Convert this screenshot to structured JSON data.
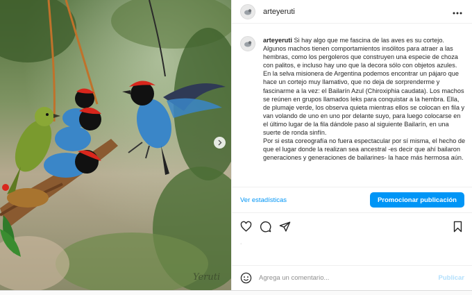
{
  "post": {
    "username": "arteyeruti",
    "caption_text": "Si hay algo que me fascina de las aves es su cortejo. Algunos machos tienen comportamientos insólitos para atraer a las hembras, como los pergoleros que construyen una especie de choza con palitos, e incluso hay uno que la decora sólo con objetos azules.",
    "caption_paragraphs": [
      "En la selva misionera de Argentina podemos encontrar un pájaro que hace un cortejo muy llamativo, que no deja de sorprenderme y fascinarme a la vez: el Bailarín Azul (Chiroxiphia caudata). Los machos se reúnen en grupos llamados leks para conquistar a la hembra. Ella, de plumaje verde, los observa quieta mientras ellos se colocan en fila y van volando de uno en uno por delante suyo, para luego colocarse en el último lugar de la fila dándole paso al siguiente Bailarín, en una suerte de ronda sinfín.",
      "Por si esta coreografía no fuera espectacular por sí misma, el hecho de que el lugar donde la realizan sea ancestral -es decir que ahí bailaron generaciones y generaciones de bailarines- la hace más hermosa aún."
    ],
    "more_icon": "ellipsis-icon",
    "watermark": "Yeruti"
  },
  "actions": {
    "stats_label": "Ver estadísticas",
    "promote_label": "Promocionar publicación",
    "icons": [
      "heart-icon",
      "comment-icon",
      "share-icon",
      "bookmark-icon"
    ],
    "likes_marker": "·"
  },
  "comment": {
    "placeholder": "Agrega un comentario...",
    "publish_label": "Publicar",
    "emoji_icon": "emoji-icon"
  },
  "colors": {
    "accent": "#0095f6",
    "publish_disabled": "#b2dffc",
    "bird_blue": "#3a86c8",
    "bird_red": "#d8261c",
    "female_green": "#7a9a2e"
  }
}
